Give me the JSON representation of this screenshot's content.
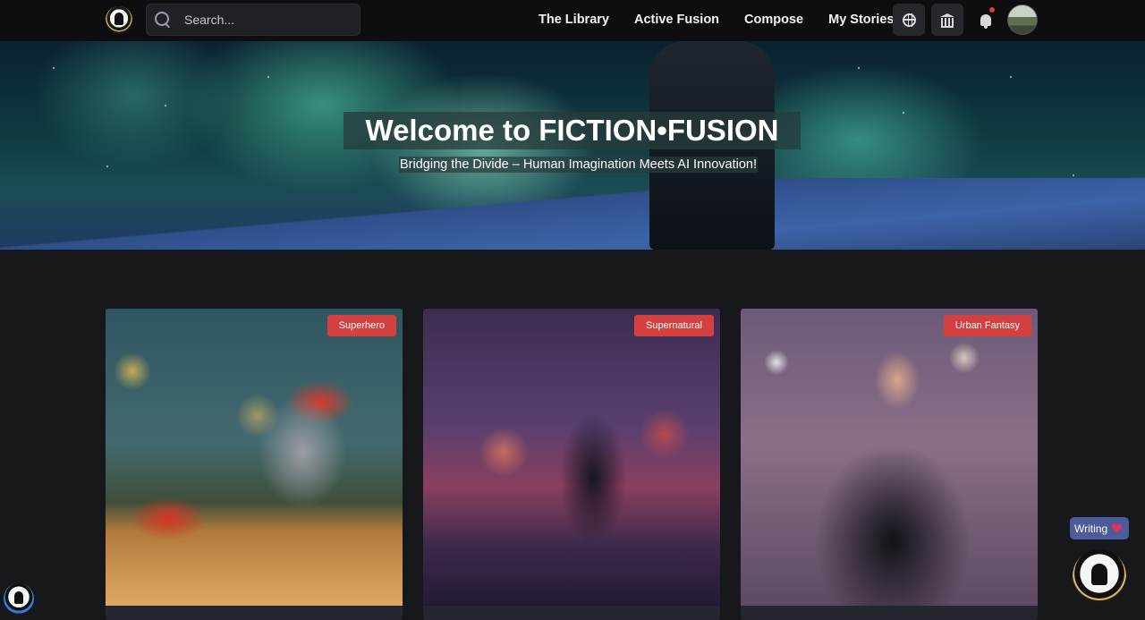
{
  "header": {
    "logo": "fiction-fusion-logo",
    "search": {
      "placeholder": "Search..."
    },
    "nav": [
      {
        "label": "The Library"
      },
      {
        "label": "Active Fusion"
      },
      {
        "label": "Compose"
      },
      {
        "label": "My Stories"
      }
    ],
    "icons": [
      "globe-icon",
      "bank-icon",
      "bell-icon"
    ],
    "notification_dot_color": "#e23b3b"
  },
  "hero": {
    "title": "Welcome to FICTION•FUSION",
    "subtitle": "Bridging the Divide – Human Imagination Meets AI Innovation!"
  },
  "cards": [
    {
      "genre": "Superhero"
    },
    {
      "genre": "Supernatural"
    },
    {
      "genre": "Urban Fantasy"
    }
  ],
  "floating": {
    "writing_label": "Writing"
  },
  "colors": {
    "badge": "#d43f3f",
    "writing_button": "#4d5b9c",
    "background": "#17181c"
  }
}
